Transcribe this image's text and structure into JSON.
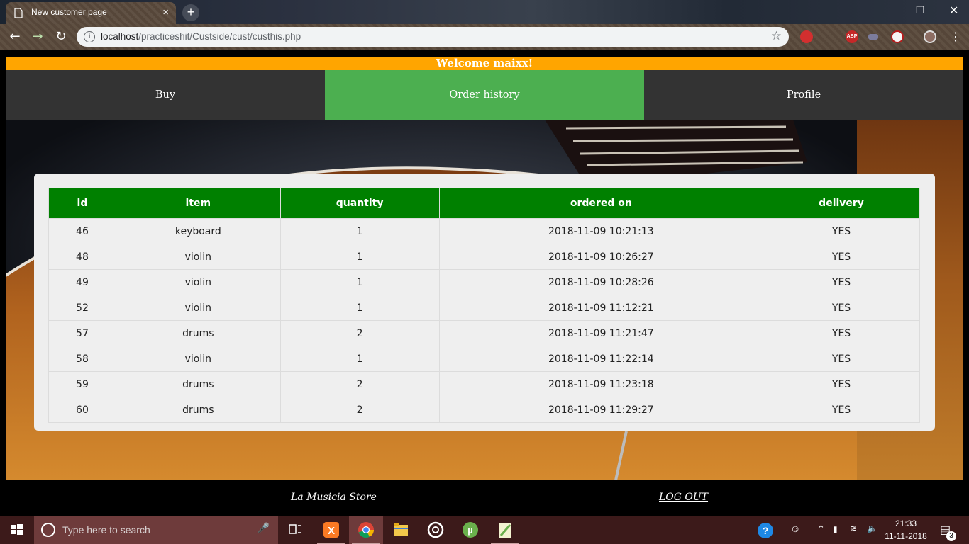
{
  "browser": {
    "tab_title": "New customer page",
    "url_host": "localhost",
    "url_path": "/practiceshit/Custside/cust/custhis.php",
    "tab_close": "×",
    "new_tab": "+",
    "ext_abp": "ABP"
  },
  "page": {
    "welcome": "Welcome maixx!",
    "nav": [
      {
        "label": "Buy",
        "active": false
      },
      {
        "label": "Order history",
        "active": true
      },
      {
        "label": "Profile",
        "active": false
      }
    ],
    "accent_orange": "#ffa500",
    "accent_green": "#4caf50",
    "table_header_green": "#008000"
  },
  "orders": {
    "columns": [
      "id",
      "item",
      "quantity",
      "ordered on",
      "delivery"
    ],
    "rows": [
      [
        "46",
        "keyboard",
        "1",
        "2018-11-09 10:21:13",
        "YES"
      ],
      [
        "48",
        "violin",
        "1",
        "2018-11-09 10:26:27",
        "YES"
      ],
      [
        "49",
        "violin",
        "1",
        "2018-11-09 10:28:26",
        "YES"
      ],
      [
        "52",
        "violin",
        "1",
        "2018-11-09 11:12:21",
        "YES"
      ],
      [
        "57",
        "drums",
        "2",
        "2018-11-09 11:21:47",
        "YES"
      ],
      [
        "58",
        "violin",
        "1",
        "2018-11-09 11:22:14",
        "YES"
      ],
      [
        "59",
        "drums",
        "2",
        "2018-11-09 11:23:18",
        "YES"
      ],
      [
        "60",
        "drums",
        "2",
        "2018-11-09 11:29:27",
        "YES"
      ]
    ]
  },
  "footer": {
    "store_name": "La Musicia Store",
    "logout": "LOG OUT"
  },
  "taskbar": {
    "search_placeholder": "Type here to search",
    "time": "21:33",
    "date": "11-11-2018",
    "notification_count": "3",
    "apps": [
      "task-view",
      "xampp",
      "chrome",
      "file-explorer",
      "groove-music",
      "utorrent",
      "notepad-plus-plus"
    ]
  }
}
